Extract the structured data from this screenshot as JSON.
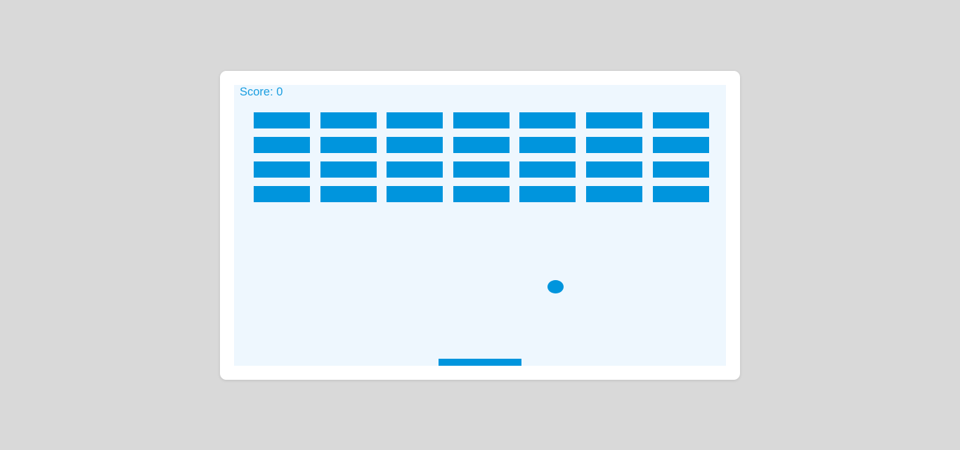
{
  "game": {
    "score_label": "Score: 0",
    "score": 0,
    "color": "#0095dd",
    "bricks": [
      [
        1,
        1,
        1,
        1,
        1,
        1,
        1
      ],
      [
        1,
        1,
        1,
        1,
        1,
        1,
        1
      ],
      [
        1,
        1,
        1,
        1,
        1,
        1,
        1
      ],
      [
        1,
        1,
        1,
        1,
        1,
        1,
        1
      ]
    ]
  }
}
